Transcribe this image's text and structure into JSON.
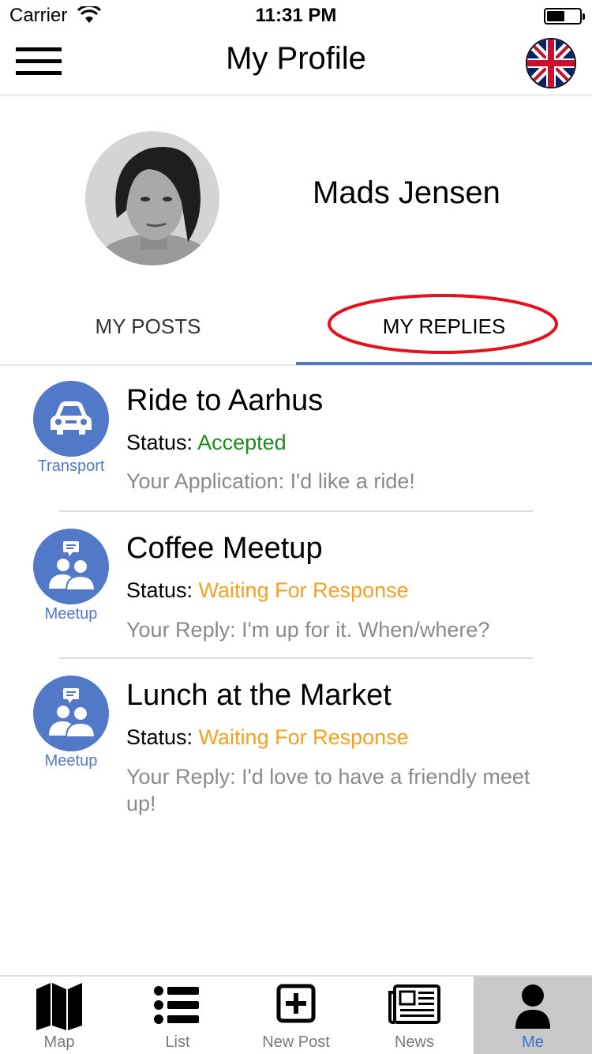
{
  "status_bar": {
    "carrier": "Carrier",
    "time": "11:31 PM",
    "battery_level": 0.55
  },
  "nav": {
    "title": "My Profile"
  },
  "profile": {
    "name": "Mads Jensen"
  },
  "tabs": [
    {
      "label": "MY POSTS",
      "selected": false
    },
    {
      "label": "MY REPLIES",
      "selected": true
    }
  ],
  "replies": [
    {
      "category": "Transport",
      "category_icon": "car-icon",
      "title": "Ride to Aarhus",
      "status_label": "Status:",
      "status_value": "Accepted",
      "status_color": "#1e8a1e",
      "message": "Your Application: I'd like a ride!"
    },
    {
      "category": "Meetup",
      "category_icon": "people-chat-icon",
      "title": "Coffee Meetup",
      "status_label": "Status:",
      "status_value": "Waiting For Response",
      "status_color": "#f5a020",
      "message": "Your Reply: I'm up for it.  When/where?"
    },
    {
      "category": "Meetup",
      "category_icon": "people-chat-icon",
      "title": "Lunch at the Market",
      "status_label": "Status:",
      "status_value": "Waiting For Response",
      "status_color": "#f5a020",
      "message": "Your Reply: I'd love to have a friendly meet up!"
    }
  ],
  "tab_bar": [
    {
      "label": "Map",
      "icon": "map-icon",
      "active": false
    },
    {
      "label": "List",
      "icon": "list-icon",
      "active": false
    },
    {
      "label": "New Post",
      "icon": "plus-square-icon",
      "active": false
    },
    {
      "label": "News",
      "icon": "newspaper-icon",
      "active": false
    },
    {
      "label": "Me",
      "icon": "person-icon",
      "active": true
    }
  ],
  "colors": {
    "accent": "#4f75c4",
    "category_blue": "#5278c8",
    "accepted": "#1e8a1e",
    "waiting": "#f5a020",
    "annotation_red": "#e8101a",
    "tab_active_bg": "#c9c9c9"
  }
}
